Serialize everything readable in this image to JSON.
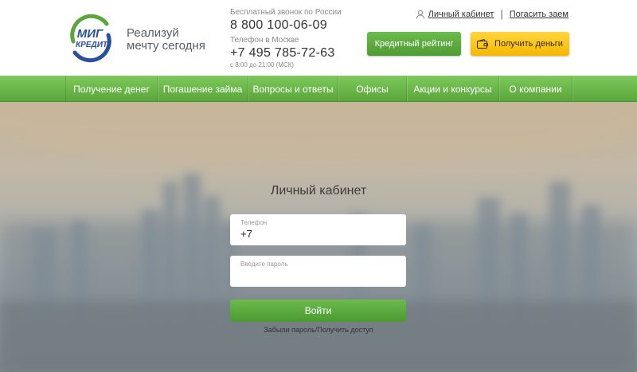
{
  "brand": {
    "logo_line1": "МИГ",
    "logo_line2": "КРЕДИТ",
    "slogan_line1": "Реализуй",
    "slogan_line2": "мечту сегодня",
    "green": "#5aa63c",
    "yellow": "#f6b800"
  },
  "phones": {
    "free_caption": "Бесплатный звонок по России",
    "free_number": "8 800 100-06-09",
    "moscow_caption": "Телефон в Москве",
    "moscow_number": "+7 495 785-72-63",
    "hours": "с 8:00 до 21:00 (МСК)"
  },
  "top_links": {
    "cabinet": "Личный кабинет",
    "separator": "|",
    "repay": "Погасить заем",
    "user_icon": "user-icon"
  },
  "buttons": {
    "rating": "Кредитный рейтинг",
    "get_money": "Получить деньги",
    "get_money_icon": "wallet-icon"
  },
  "nav": {
    "items": [
      {
        "label": "Получение денег"
      },
      {
        "label": "Погашение займа"
      },
      {
        "label": "Вопросы и ответы"
      },
      {
        "label": "Офисы"
      },
      {
        "label": "Акции и конкурсы"
      },
      {
        "label": "О компании"
      }
    ]
  },
  "login": {
    "title": "Личный кабинет",
    "phone_label": "Телефон",
    "phone_value": "+7",
    "password_placeholder": "Введите пароль",
    "submit": "Войти",
    "forgot": "Забыли пароль/Получить доступ"
  }
}
